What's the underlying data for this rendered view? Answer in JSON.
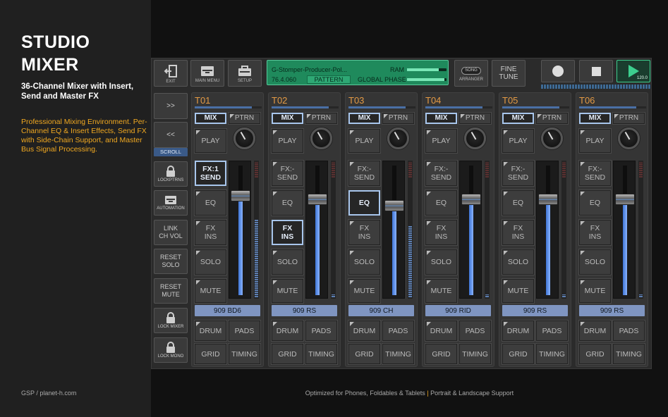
{
  "promo": {
    "title": "STUDIO MIXER",
    "subtitle": "36-Channel Mixer with Insert, Send and Master FX",
    "description": "Professional Mixing Environment. Per-Channel EQ & Insert Effects, Send FX with Side-Chain Support, and Master Bus Signal Processing.",
    "credit": "GSP / planet-h.com"
  },
  "footer": {
    "left": "Optimized for Phones, Foldables & Tablets",
    "sep": "|",
    "right": "Portrait & Landscape Support"
  },
  "toolbar": {
    "exit": "EXIT",
    "main_menu": "MAIN MENU",
    "setup": "SETUP",
    "song_badge": "SONG",
    "arranger": "ARRANGER",
    "fine": "FINE",
    "tune": "TUNE",
    "tempo": "120.0"
  },
  "lcd": {
    "song_name": "G-Stomper-Producer-Pol...",
    "position": "76.4.060",
    "mode": "PATTERN",
    "ram_label": "RAM",
    "ram_level": 0.8,
    "phase_label": "GLOBAL PHASE",
    "phase_level": 0.95
  },
  "sidebar": {
    "next": ">>",
    "prev": "<<",
    "scroll": "SCROLL",
    "lock_ptrns": "LOCKPTRNS",
    "automation": "AUTOMATION",
    "link_1": "LINK",
    "link_2": "CH VOL",
    "reset_solo_1": "RESET",
    "reset_solo_2": "SOLO",
    "reset_mute_1": "RESET",
    "reset_mute_2": "MUTE",
    "lock_mixer": "LOCK MIXER",
    "lock_mono": "LOCK MONO"
  },
  "labels": {
    "mix": "MIX",
    "ptrn": "PTRN",
    "play": "PLAY",
    "fx_prefix": "FX:",
    "send": "SEND",
    "eq": "EQ",
    "fx": "FX",
    "ins": "INS",
    "solo": "SOLO",
    "mute": "MUTE",
    "drum": "DRUM",
    "pads": "PADS",
    "grid": "GRID",
    "timing": "TIMING"
  },
  "channels": [
    {
      "name": "T01",
      "fx": "1",
      "instrument": "909 BD6",
      "fader": 0.79,
      "vu": 0.58,
      "selected": "send"
    },
    {
      "name": "T02",
      "fx": "-",
      "instrument": "909 RS",
      "fader": 0.76,
      "vu": 0.02,
      "selected": "fxins"
    },
    {
      "name": "T03",
      "fx": "-",
      "instrument": "909 CH",
      "fader": 0.71,
      "vu": 0.53,
      "selected": "eq"
    },
    {
      "name": "T04",
      "fx": "-",
      "instrument": "909 RID",
      "fader": 0.76,
      "vu": 0.02,
      "selected": ""
    },
    {
      "name": "T05",
      "fx": "-",
      "instrument": "909 RS",
      "fader": 0.76,
      "vu": 0.02,
      "selected": ""
    },
    {
      "name": "T06",
      "fx": "-",
      "instrument": "909 RS",
      "fader": 0.76,
      "vu": 0.02,
      "selected": ""
    }
  ],
  "icons": {
    "exit": "exit-door-icon",
    "main_menu": "drawer-icon",
    "setup": "toolbox-icon",
    "record": "record-icon",
    "stop": "stop-icon",
    "play": "play-icon",
    "lock": "padlock-icon",
    "automation": "drawer-icon"
  },
  "colors": {
    "accent_orange": "#e39a45",
    "lcd_green": "#1f8a5c",
    "play_green": "#3ccf8e",
    "fader_blue": "#5d8de0",
    "instrument_blue": "#7f95c1"
  }
}
